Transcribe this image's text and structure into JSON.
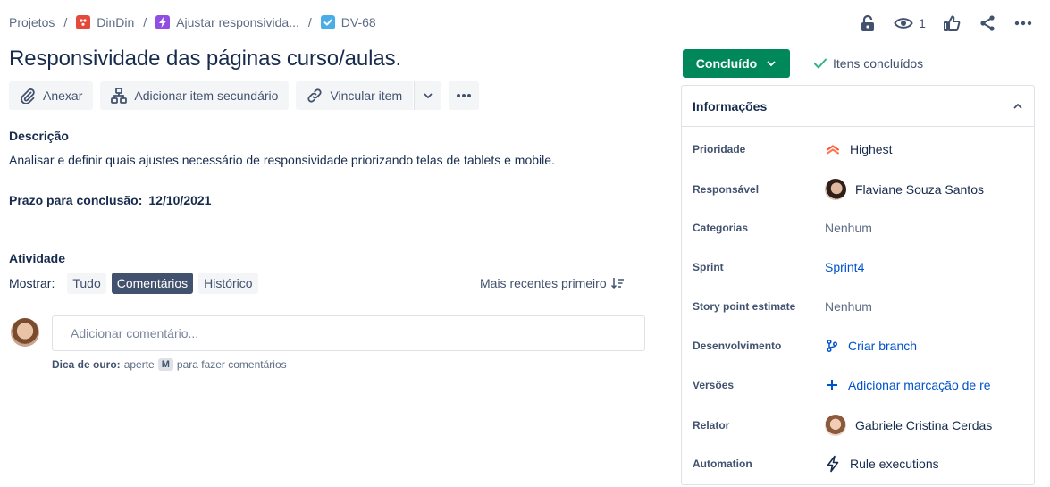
{
  "breadcrumb": {
    "items": [
      "Projetos",
      "DinDin",
      "Ajustar responsivida...",
      "DV-68"
    ],
    "separator": "/"
  },
  "top_actions": {
    "watch_count": "1"
  },
  "issue": {
    "title": "Responsividade das páginas curso/aulas."
  },
  "toolbar": {
    "attach": "Anexar",
    "add_child": "Adicionar item secundário",
    "link_item": "Vincular item"
  },
  "description": {
    "heading": "Descrição",
    "text": "Analisar e definir quais ajustes necessário de responsividade priorizando telas de tablets e mobile.",
    "deadline_label": "Prazo para conclusão:",
    "deadline_value": "12/10/2021"
  },
  "activity": {
    "heading": "Atividade",
    "show_label": "Mostrar:",
    "filters": [
      "Tudo",
      "Comentários",
      "Histórico"
    ],
    "active_filter": "Comentários",
    "sort_label": "Mais recentes primeiro",
    "comment_placeholder": "Adicionar comentário...",
    "tip_bold": "Dica de ouro:",
    "tip_pre": "aperte",
    "tip_key": "M",
    "tip_post": "para fazer comentários"
  },
  "status": {
    "button_label": "Concluído",
    "done_label": "Itens concluídos",
    "button_color": "#00875a"
  },
  "details": {
    "heading": "Informações",
    "fields": [
      {
        "label": "Prioridade",
        "value": "Highest",
        "icon": "priority-highest-icon"
      },
      {
        "label": "Responsável",
        "value": "Flaviane Souza Santos",
        "icon": "avatar"
      },
      {
        "label": "Categorias",
        "value": "Nenhum"
      },
      {
        "label": "Sprint",
        "value": "Sprint4"
      },
      {
        "label": "Story point estimate",
        "value": "Nenhum"
      },
      {
        "label": "Desenvolvimento",
        "value": "Criar branch",
        "icon": "branch-icon"
      },
      {
        "label": "Versões",
        "value": "Adicionar marcação de re",
        "icon": "plus-icon"
      },
      {
        "label": "Relator",
        "value": "Gabriele Cristina Cerdas",
        "icon": "avatar"
      },
      {
        "label": "Automation",
        "value": "Rule executions",
        "icon": "lightning-icon"
      }
    ]
  },
  "colors": {
    "accent_blue": "#0052cc",
    "text_primary": "#172b4d",
    "text_secondary": "#42526e",
    "priority_red": "#ff5630"
  }
}
